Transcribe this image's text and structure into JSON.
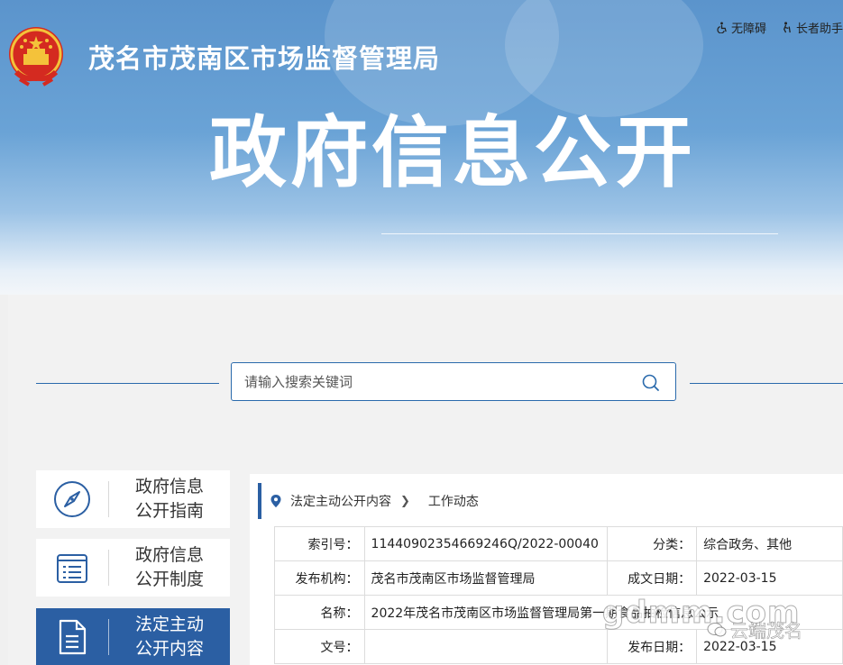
{
  "header": {
    "site_title": "茂名市茂南区市场监督管理局",
    "hero_title": "政府信息公开",
    "util_links": [
      {
        "label": "无障碍",
        "icon": "wheelchair-icon"
      },
      {
        "label": "长者助手",
        "icon": "elder-icon"
      }
    ]
  },
  "search": {
    "placeholder": "请输入搜索关键词",
    "button_icon": "search-icon"
  },
  "sidebar": {
    "items": [
      {
        "label": "政府信息\n公开指南",
        "icon": "compass-icon",
        "active": false
      },
      {
        "label": "政府信息\n公开制度",
        "icon": "document-list-icon",
        "active": false
      },
      {
        "label": "法定主动\n公开内容",
        "icon": "file-icon",
        "active": true
      }
    ]
  },
  "breadcrumb": {
    "icon": "location-pin-icon",
    "items": [
      "法定主动公开内容",
      "工作动态"
    ]
  },
  "meta": {
    "index_key": "索引号：",
    "index_val": "11440902354669246Q/2022-00040",
    "category_key": "分类：",
    "category_val": "综合政务、其他",
    "publisher_key": "发布机构：",
    "publisher_val": "茂名市茂南区市场监督管理局",
    "created_key": "成文日期：",
    "created_val": "2022-03-15",
    "name_key": "名称：",
    "name_val": "2022年茂名市茂南区市场监督管理局第一期食品抽检信息公示",
    "doc_key": "文号：",
    "doc_val": "",
    "pubdate_key": "发布日期：",
    "pubdate_val": "2022-03-15"
  },
  "watermark": {
    "site": "gdmm.com",
    "brand": "云端茂名"
  },
  "colors": {
    "accent": "#2b5fa3",
    "border_blue": "#2a6aac"
  }
}
